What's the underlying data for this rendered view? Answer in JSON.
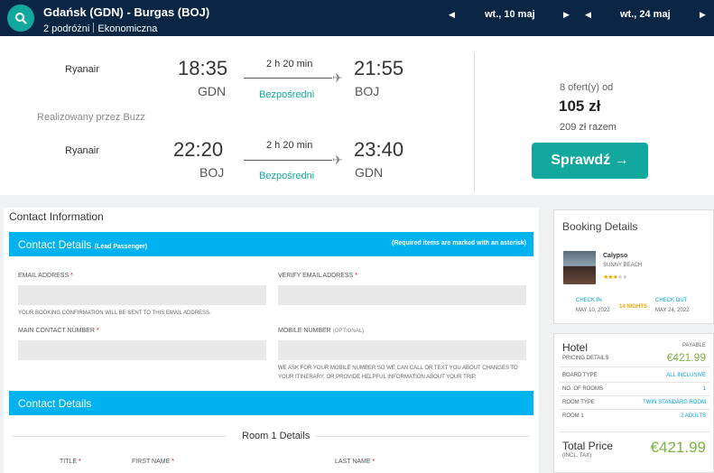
{
  "search": {
    "route": "Gdańsk (GDN) - Burgas (BOJ)",
    "passengers": "2 podróżni",
    "cabin": "Ekonomiczna",
    "depart_date": "wt., 10 maj",
    "return_date": "wt., 24 maj"
  },
  "outbound": {
    "airline": "Ryanair",
    "dep_time": "18:35",
    "dep_code": "GDN",
    "duration": "2 h 20 min",
    "stops": "Bezpośredni",
    "arr_time": "21:55",
    "arr_code": "BOJ"
  },
  "operated_by": "Realizowany przez Buzz",
  "inbound": {
    "airline": "Ryanair",
    "dep_time": "22:20",
    "dep_code": "BOJ",
    "duration": "2 h 20 min",
    "stops": "Bezpośredni",
    "arr_time": "23:40",
    "arr_code": "GDN"
  },
  "offer": {
    "offers_from": "8 ofert(y) od",
    "price": "105 zł",
    "total": "209 zł razem",
    "cta": "Sprawdź →"
  },
  "form": {
    "title": "Contact Information",
    "section1_title": "Contact Details",
    "section1_sub": "(Lead Passenger)",
    "required_note": "(Required items are marked with an asterisk)",
    "email_label": "EMAIL ADDRESS",
    "verify_email_label": "VERIFY EMAIL ADDRESS",
    "email_help": "YOUR BOOKING CONFIRMATION WILL BE SENT TO THIS EMAIL ADDRESS.",
    "main_number_label": "MAIN CONTACT NUMBER",
    "mobile_label": "MOBILE NUMBER",
    "mobile_optional": "(OPTIONAL)",
    "mobile_help": "WE ASK FOR YOUR MOBILE NUMBER SO WE CAN CALL OR TEXT YOU ABOUT CHANGES TO YOUR ITINERARY, OR PROVIDE HELPFUL INFORMATION ABOUT YOUR TRIP.",
    "section2_title": "Contact Details",
    "room_title": "Room 1 Details",
    "title_label": "TITLE",
    "first_name_label": "FIRST NAME",
    "last_name_label": "LAST NAME",
    "asterisk": "*"
  },
  "booking": {
    "title": "Booking Details",
    "hotel_name": "Calypso",
    "hotel_location": "SUNNY BEACH",
    "stars": 3,
    "max_stars": 5,
    "check_in_label": "CHECK IN",
    "check_in_date": "MAY 10, 2022",
    "nights": "14 NIGHTS",
    "check_out_label": "CHECK OUT",
    "check_out_date": "MAY 24, 2022"
  },
  "pricing": {
    "heading": "Hotel",
    "payable": "PAYABLE",
    "pricing_details": "PRICING DETAILS",
    "pricing_value": "€421.99",
    "rows": [
      {
        "label": "BOARD TYPE",
        "value": "ALL INCLUSIVE"
      },
      {
        "label": "NO. OF ROOMS",
        "value": "1"
      },
      {
        "label": "ROOM TYPE",
        "value": "TWIN STANDARD ROOM"
      },
      {
        "label": "ROOM 1",
        "value": "2 ADULTS"
      }
    ],
    "total_label": "Total Price",
    "total_sub": "(INCL. TAX)",
    "total_value": "€421.99"
  },
  "colors": {
    "topbar": "#0b2545",
    "accent": "#12a89d",
    "form_header": "#00b2ef",
    "price_green": "#7cb342"
  }
}
